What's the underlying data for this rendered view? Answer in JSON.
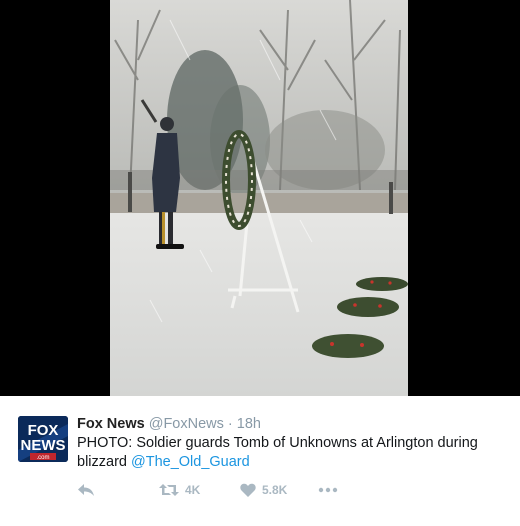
{
  "tweet": {
    "author_name": "Fox News",
    "handle": "@FoxNews",
    "separator": " · ",
    "time": "18h",
    "text": "PHOTO: Soldier guards Tomb of Unknowns at Arlington during blizzard ",
    "mention": "@The_Old_Guard",
    "avatar_lines": [
      "FOX",
      "NEWS",
      ".com"
    ]
  },
  "actions": {
    "reply_icon": "reply-icon",
    "retweet_icon": "retweet-icon",
    "retweet_count": "4K",
    "like_icon": "heart-icon",
    "like_count": "5.8K",
    "more_icon": "more-dots-icon"
  },
  "colors": {
    "link": "#1b95e0",
    "muted": "#8899a6",
    "action_icon": "#aab8c2",
    "avatar_bg": "#0b2a5a"
  }
}
